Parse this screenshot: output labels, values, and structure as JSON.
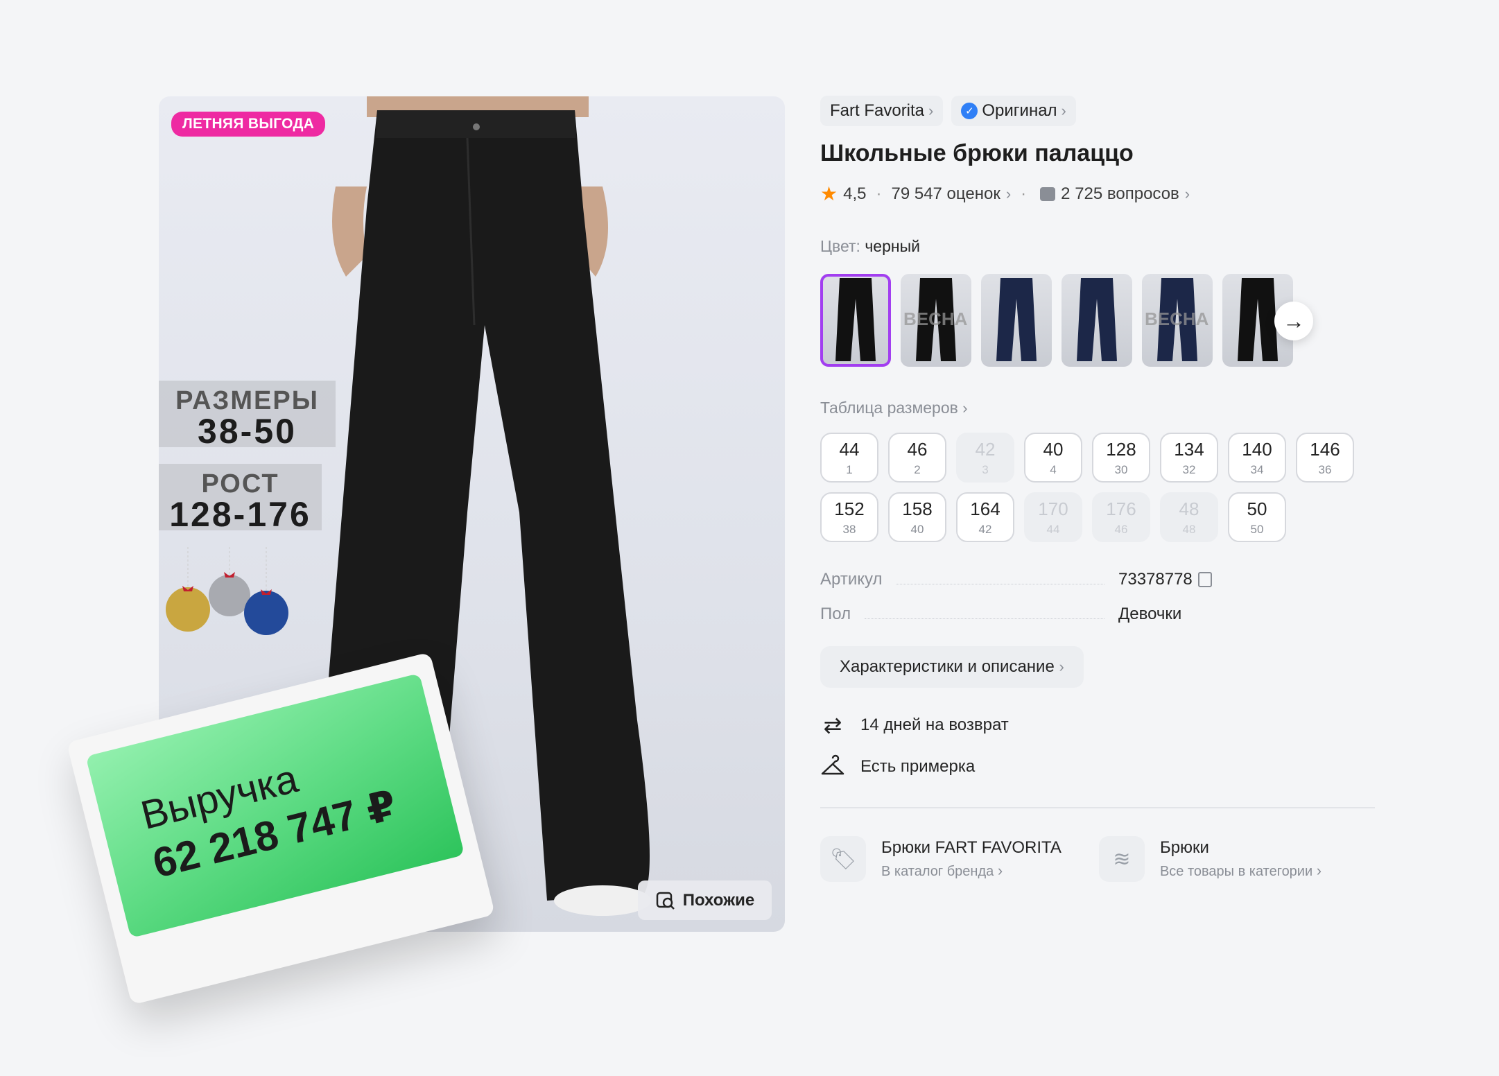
{
  "product_image": {
    "promo_badge": "ЛЕТНЯЯ ВЫГОДА",
    "sizes_label": "РАЗМЕРЫ",
    "sizes_value": "38-50",
    "height_label": "РОСТ",
    "height_value": "128-176",
    "similar_button": "Похожие"
  },
  "revenue_card": {
    "label": "Выручка",
    "value": "62 218 747 ₽"
  },
  "brand_chip": "Fart Favorita",
  "original_chip": "Оригинал",
  "title": "Школьные брюки палаццо",
  "rating": {
    "score": "4,5",
    "reviews": "79 547 оценок",
    "questions": "2 725 вопросов"
  },
  "color": {
    "label": "Цвет:",
    "value": "черный",
    "thumbnails": [
      {
        "tone": "#111111",
        "watermark": ""
      },
      {
        "tone": "#111111",
        "watermark": "ВЕСНА"
      },
      {
        "tone": "#1c2748",
        "watermark": ""
      },
      {
        "tone": "#1c2748",
        "watermark": ""
      },
      {
        "tone": "#1c2748",
        "watermark": "ВЕСНА"
      },
      {
        "tone": "#111111",
        "watermark": ""
      }
    ]
  },
  "size_table_link": "Таблица размеров",
  "sizes": [
    {
      "size": "44",
      "ru": "1",
      "available": true
    },
    {
      "size": "46",
      "ru": "2",
      "available": true
    },
    {
      "size": "42",
      "ru": "3",
      "available": false
    },
    {
      "size": "40",
      "ru": "4",
      "available": true
    },
    {
      "size": "128",
      "ru": "30",
      "available": true
    },
    {
      "size": "134",
      "ru": "32",
      "available": true
    },
    {
      "size": "140",
      "ru": "34",
      "available": true
    },
    {
      "size": "146",
      "ru": "36",
      "available": true
    },
    {
      "size": "152",
      "ru": "38",
      "available": true
    },
    {
      "size": "158",
      "ru": "40",
      "available": true
    },
    {
      "size": "164",
      "ru": "42",
      "available": true
    },
    {
      "size": "170",
      "ru": "44",
      "available": false
    },
    {
      "size": "176",
      "ru": "46",
      "available": false
    },
    {
      "size": "48",
      "ru": "48",
      "available": false
    },
    {
      "size": "50",
      "ru": "50",
      "available": true
    }
  ],
  "specs": {
    "article_label": "Артикул",
    "article_value": "73378778",
    "gender_label": "Пол",
    "gender_value": "Девочки"
  },
  "characteristics_button": "Характеристики и описание",
  "features": {
    "return": "14 дней на возврат",
    "fitting": "Есть примерка"
  },
  "links": {
    "brand_title": "Брюки FART FAVORITA",
    "brand_sub": "В каталог бренда",
    "category_title": "Брюки",
    "category_sub": "Все товары в категории"
  },
  "colors": {
    "accent_purple": "#a23ef0",
    "promo_pink": "#ee2aa2",
    "verified_blue": "#2f7ff6",
    "star_orange": "#ff8a00",
    "revenue_green": "#2ec45c"
  }
}
